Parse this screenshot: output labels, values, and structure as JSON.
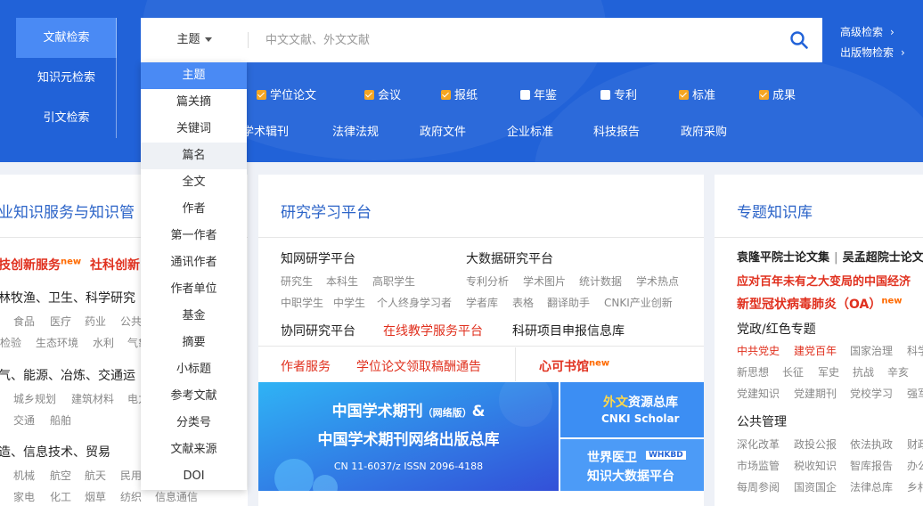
{
  "nav": {
    "items": [
      "文献检索",
      "知识元检索",
      "引文检索"
    ]
  },
  "search": {
    "field_label": "主题",
    "placeholder": "中文文献、外文文献"
  },
  "advanced": {
    "adv_search": "高级检索",
    "pub_search": "出版物检索"
  },
  "categories": [
    {
      "label": "学位论文",
      "checked": true
    },
    {
      "label": "会议",
      "checked": true
    },
    {
      "label": "报纸",
      "checked": true
    },
    {
      "label": "年鉴",
      "checked": false
    },
    {
      "label": "专利",
      "checked": false
    },
    {
      "label": "标准",
      "checked": true
    },
    {
      "label": "成果",
      "checked": true
    }
  ],
  "links": [
    "学术辑刊",
    "法律法规",
    "政府文件",
    "企业标准",
    "科技报告",
    "政府采购"
  ],
  "dropdown": {
    "options": [
      "主题",
      "篇关摘",
      "关键词",
      "篇名",
      "全文",
      "作者",
      "第一作者",
      "通讯作者",
      "作者单位",
      "基金",
      "摘要",
      "小标题",
      "参考文献",
      "分类号",
      "文献来源",
      "DOI"
    ]
  },
  "left_panel": {
    "title": "业知识服务与知识管",
    "featured_1": "技创新服务",
    "featured_2": "社科创新",
    "new_badge": "new",
    "group1": "林牧渔、卫生、科学研究",
    "group1_items_a": [
      "食品",
      "医疗",
      "药业",
      "公共"
    ],
    "group1_items_b": [
      "检验",
      "生态环境",
      "水利",
      "气象"
    ],
    "group2": "气、能源、冶炼、交通运",
    "group2_items_a": [
      "城乡规划",
      "建筑材料",
      "电力"
    ],
    "group2_items_b": [
      "交通",
      "船舶"
    ],
    "group3": "造、信息技术、贸易",
    "group3_items_a": [
      "机械",
      "航空",
      "航天",
      "民用"
    ],
    "group3_items_b": [
      "家电",
      "化工",
      "烟草",
      "纺织",
      "信息通信"
    ]
  },
  "research_panel": {
    "title": "研究学习平台",
    "platform1": "知网研学平台",
    "platform2": "大数据研究平台",
    "row1": [
      "研究生",
      "本科生",
      "高职学生"
    ],
    "row1b": [
      "专利分析",
      "学术图片",
      "统计数据",
      "学术热点"
    ],
    "row2": [
      "中职学生",
      "中学生",
      "个人终身学习者"
    ],
    "row2b": [
      "学者库",
      "表格",
      "翻译助手",
      "CNKI产业创新"
    ],
    "collab": "协同研究平台",
    "online": "在线教学服务平台",
    "proj": "科研项目申报信息库",
    "author_svc": "作者服务",
    "thesis": "学位论文领取稿酬通告",
    "xinke": "心可书馆",
    "new_badge": "new",
    "banner_line1": "中国学术期刊",
    "banner_net": "（网络版）",
    "banner_amp": "&",
    "banner_line2": "中国学术期刊网络出版总库",
    "banner_issn": "CN 11-6037/z   ISSN 2096-4188",
    "ext_title_a": "外文",
    "ext_title_b": "资源总库",
    "ext_sub": "CNKI Scholar",
    "world_title": "世界医卫",
    "world_tag": "WHKBD",
    "world_sub": "知识大数据平台"
  },
  "right_panel": {
    "title": "专题知识库",
    "line1a": "袁隆平院士论文集",
    "line1b": "吴孟超院士论文",
    "line2": "应对百年未有之大变局的中国经济",
    "line3": "新型冠状病毒肺炎（OA）",
    "new_badge": "new",
    "sec1": "党政/红色专题",
    "sec1_r1": [
      "中共党史",
      "建党百年",
      "国家治理",
      "科学"
    ],
    "sec1_r2": [
      "新思想",
      "长征",
      "军史",
      "抗战",
      "辛亥"
    ],
    "sec1_r3": [
      "党建知识",
      "党建期刊",
      "党校学习",
      "强军"
    ],
    "sec2": "公共管理",
    "sec2_r1": [
      "深化改革",
      "政投公报",
      "依法执政",
      "财政"
    ],
    "sec2_r2": [
      "市场监管",
      "税收知识",
      "智库报告",
      "办公"
    ],
    "sec2_r3": [
      "每周参阅",
      "国资国企",
      "法律总库",
      "乡村"
    ]
  }
}
